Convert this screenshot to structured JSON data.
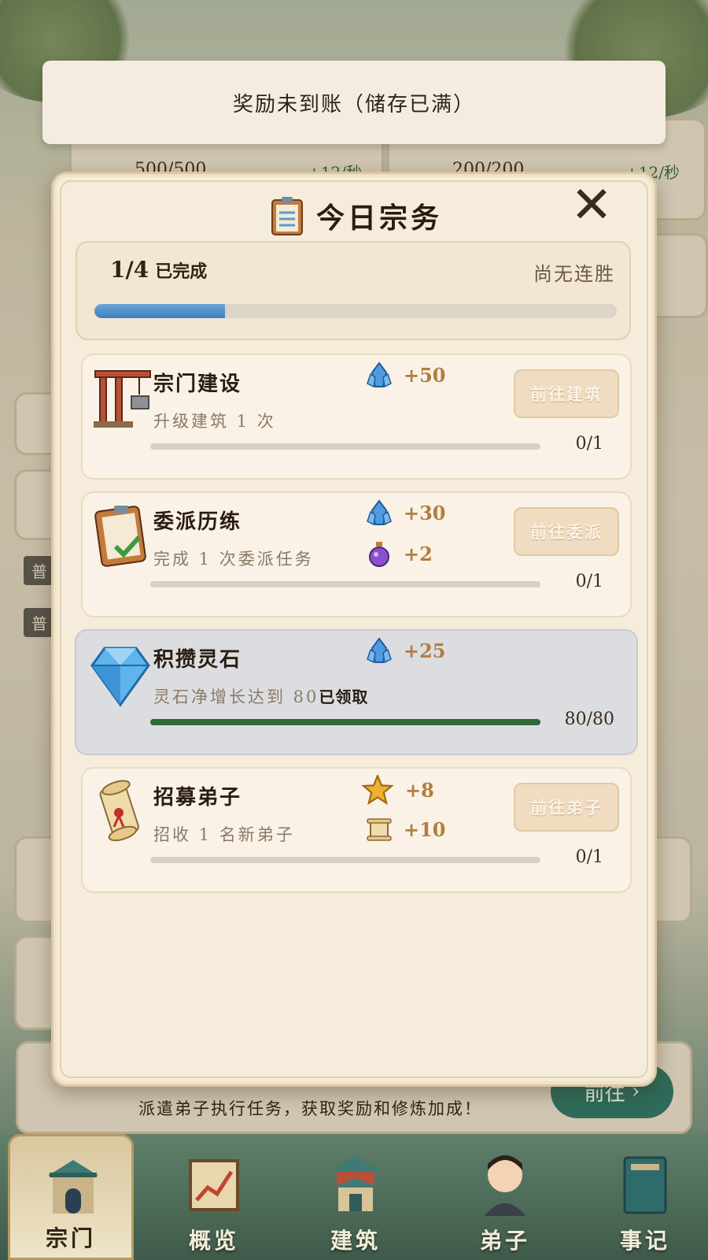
{
  "toast": {
    "message": "奖励未到账（储存已满）"
  },
  "background": {
    "resource_left": {
      "value": "500/500",
      "rate": "+12/秒"
    },
    "resource_right": {
      "value": "200/200",
      "rate": "+12/秒"
    },
    "hint_text": "派遣弟子执行任务，获取奖励和修炼加成！",
    "go_label": "前往"
  },
  "modal": {
    "title": "今日宗务",
    "close_icon": "close-x-icon",
    "summary": {
      "completed": "1/4",
      "completed_suffix": "已完成",
      "streak": "尚无连胜",
      "progress_fraction": 0.25
    },
    "tasks": [
      {
        "name": "宗门建设",
        "desc": "升级建筑 1 次",
        "icon": "crane-icon",
        "rewards": [
          {
            "icon": "spirit-stone-icon",
            "amount": "+50"
          }
        ],
        "count": "0/1",
        "progress": 0,
        "button": "前往建筑",
        "claimed": ""
      },
      {
        "name": "委派历练",
        "desc": "完成 1 次委派任务",
        "icon": "clipboard-check-icon",
        "rewards": [
          {
            "icon": "spirit-stone-icon",
            "amount": "+30"
          },
          {
            "icon": "potion-icon",
            "amount": "+2"
          }
        ],
        "count": "0/1",
        "progress": 0,
        "button": "前往委派",
        "claimed": ""
      },
      {
        "name": "积攒灵石",
        "desc": "灵石净增长达到 80",
        "icon": "diamond-icon",
        "rewards": [
          {
            "icon": "spirit-stone-icon",
            "amount": "+25"
          }
        ],
        "count": "80/80",
        "progress": 1,
        "button": "",
        "claimed": "已领取"
      },
      {
        "name": "招募弟子",
        "desc": "招收 1 名新弟子",
        "icon": "scroll-icon",
        "rewards": [
          {
            "icon": "star-icon",
            "amount": "+8"
          },
          {
            "icon": "paper-scroll-icon",
            "amount": "+10"
          }
        ],
        "count": "0/1",
        "progress": 0,
        "button": "前往弟子",
        "claimed": ""
      }
    ]
  },
  "nav": {
    "items": [
      {
        "label": "宗门",
        "icon": "sect-gate-icon",
        "active": true
      },
      {
        "label": "概览",
        "icon": "chart-scroll-icon",
        "active": false
      },
      {
        "label": "建筑",
        "icon": "pagoda-icon",
        "active": false
      },
      {
        "label": "弟子",
        "icon": "disciple-icon",
        "active": false
      },
      {
        "label": "事记",
        "icon": "book-icon",
        "active": false
      }
    ]
  },
  "colors": {
    "accent_blue": "#3f7fba",
    "progress_green": "#2d6a35",
    "reward_gold": "#b27e3e",
    "nav_green": "#3f5a4a"
  }
}
